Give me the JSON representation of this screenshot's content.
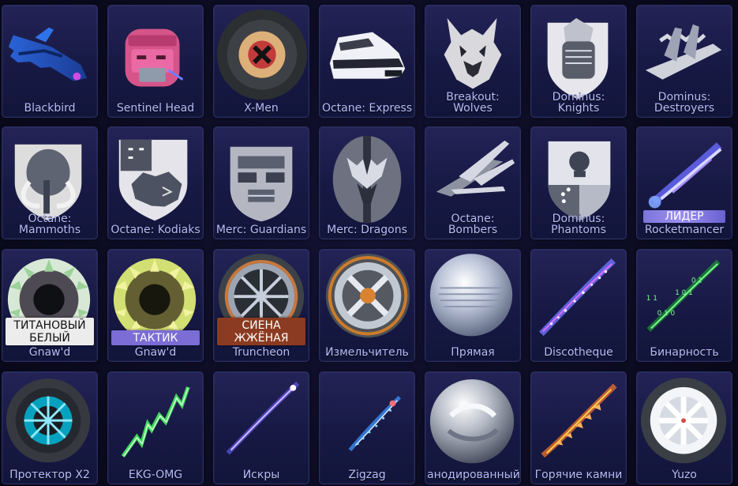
{
  "items": [
    {
      "label": "Blackbird"
    },
    {
      "label": "Sentinel Head"
    },
    {
      "label": "X-Men"
    },
    {
      "label": "Octane: Express"
    },
    {
      "label": "Breakout:\nWolves"
    },
    {
      "label": "Dominus:\nKnights"
    },
    {
      "label": "Dominus:\nDestroyers"
    },
    {
      "label": "Octane:\nMammoths"
    },
    {
      "label": "Octane: Kodiaks"
    },
    {
      "label": "Merc: Guardians"
    },
    {
      "label": "Merc: Dragons"
    },
    {
      "label": "Octane: Bombers"
    },
    {
      "label": "Dominus:\nPhantoms"
    },
    {
      "label": "Rocketmancer",
      "badge": "ЛИДЕР"
    },
    {
      "label": "Gnaw'd",
      "badge": "ТИТАНОВЫЙ\nБЕЛЫЙ"
    },
    {
      "label": "Gnaw'd",
      "badge": "ТАКТИК"
    },
    {
      "label": "Truncheon",
      "badge": "СИЕНА\nЖЖЁНАЯ"
    },
    {
      "label": "Измельчитель"
    },
    {
      "label": "Прямая"
    },
    {
      "label": "Discotheque"
    },
    {
      "label": "Бинарность"
    },
    {
      "label": "Протектор X2"
    },
    {
      "label": "EKG-OMG"
    },
    {
      "label": "Искры"
    },
    {
      "label": "Zigzag"
    },
    {
      "label": "анодированный"
    },
    {
      "label": "Горячие камни"
    },
    {
      "label": "Yuzo"
    }
  ],
  "colors": {
    "background": "#0c0c24",
    "tile": "#1a1c46",
    "label": "#b7bdfb",
    "badge_white": "#ececec",
    "badge_purple": "#7b6cd6",
    "badge_sienna": "#8b3b21"
  }
}
